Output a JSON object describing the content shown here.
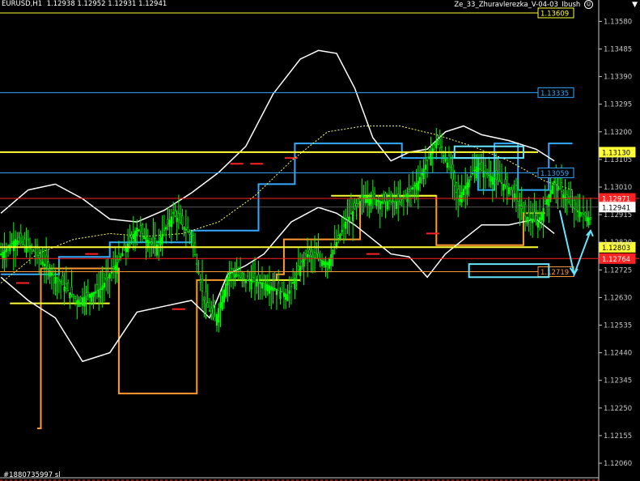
{
  "header": {
    "symbol": "EURUSD,H1",
    "ohlc": "1.12938 1.12952 1.12931 1.12941",
    "indicator": "Ze_33_Zhuravlerezka_V-04-03_Ibush"
  },
  "footer": {
    "text": "#1880735997 sl"
  },
  "colors": {
    "background": "#000000",
    "axis": "#c8c8c8",
    "candle": "#00ff00",
    "band": "#ffffff",
    "middle_dash": "#ffff66",
    "blue_step": "#33aaff",
    "orange_step": "#ff9933",
    "yellow_step": "#ffff33",
    "red_tick": "#ff2222",
    "cyan": "#66e6ff"
  },
  "chart_data": {
    "type": "line",
    "y_axis_ticks": [
      "1.13580",
      "1.13485",
      "1.13390",
      "1.13295",
      "1.13200",
      "1.13105",
      "1.13010",
      "1.12915",
      "1.12820",
      "1.12725",
      "1.12630",
      "1.12535",
      "1.12440",
      "1.12345",
      "1.12250",
      "1.12155",
      "1.12060"
    ],
    "ylim": [
      1.1201,
      1.1362
    ],
    "n_bars": 330,
    "current_price": {
      "value": 1.12941,
      "label": "1.12941"
    },
    "horizontal_lines": [
      {
        "value": 1.13609,
        "label": "1.13609",
        "kind": "yellow-thin"
      },
      {
        "value": 1.13335,
        "label": "1.13335",
        "kind": "blue"
      },
      {
        "value": 1.1313,
        "label": "1.13130",
        "kind": "yellow-thick"
      },
      {
        "value": 1.13059,
        "label": "1.13059",
        "kind": "blue"
      },
      {
        "value": 1.12971,
        "label": "1.12971",
        "kind": "red"
      },
      {
        "value": 1.12803,
        "label": "1.12803",
        "kind": "yellow-thick"
      },
      {
        "value": 1.12764,
        "label": "1.12764",
        "kind": "red"
      },
      {
        "value": 1.12719,
        "label": "1.12719",
        "kind": "orange"
      }
    ],
    "close_path": [
      [
        0,
        1.1278
      ],
      [
        8,
        1.1283
      ],
      [
        18,
        1.1279
      ],
      [
        30,
        1.127
      ],
      [
        42,
        1.1262
      ],
      [
        55,
        1.1266
      ],
      [
        65,
        1.1276
      ],
      [
        75,
        1.1287
      ],
      [
        85,
        1.128
      ],
      [
        95,
        1.1292
      ],
      [
        105,
        1.1284
      ],
      [
        112,
        1.1262
      ],
      [
        118,
        1.1255
      ],
      [
        126,
        1.1272
      ],
      [
        135,
        1.1269
      ],
      [
        145,
        1.1268
      ],
      [
        158,
        1.1264
      ],
      [
        168,
        1.1278
      ],
      [
        180,
        1.1275
      ],
      [
        190,
        1.1289
      ],
      [
        200,
        1.1298
      ],
      [
        210,
        1.1296
      ],
      [
        220,
        1.1296
      ],
      [
        230,
        1.1303
      ],
      [
        240,
        1.1317
      ],
      [
        247,
        1.1308
      ],
      [
        252,
        1.1297
      ],
      [
        262,
        1.1308
      ],
      [
        272,
        1.1304
      ],
      [
        282,
        1.13
      ],
      [
        289,
        1.1291
      ],
      [
        296,
        1.1289
      ],
      [
        305,
        1.1303
      ],
      [
        315,
        1.1294
      ],
      [
        325,
        1.129
      ]
    ],
    "channels": {
      "blue_upper": [
        [
          0,
          1.1271
        ],
        [
          32,
          1.1271
        ],
        [
          32,
          1.1277
        ],
        [
          60,
          1.1277
        ],
        [
          60,
          1.1282
        ],
        [
          105,
          1.1282
        ],
        [
          105,
          1.1286
        ],
        [
          142,
          1.1286
        ],
        [
          142,
          1.1302
        ],
        [
          162,
          1.1302
        ],
        [
          162,
          1.1316
        ],
        [
          221,
          1.1316
        ],
        [
          221,
          1.1311
        ],
        [
          263,
          1.1311
        ],
        [
          263,
          1.13
        ],
        [
          272,
          1.13
        ],
        [
          272,
          1.1316
        ],
        [
          285,
          1.1316
        ],
        [
          285,
          1.13
        ],
        [
          302,
          1.13
        ],
        [
          302,
          1.1316
        ],
        [
          315,
          1.1316
        ]
      ],
      "orange_lower": [
        [
          20,
          1.1218
        ],
        [
          20,
          1.1218
        ],
        [
          22,
          1.1218
        ],
        [
          22,
          1.1273
        ],
        [
          65,
          1.1273
        ],
        [
          65,
          1.123
        ],
        [
          108,
          1.123
        ],
        [
          108,
          1.1269
        ],
        [
          152,
          1.1269
        ],
        [
          152,
          1.1271
        ],
        [
          156,
          1.1271
        ],
        [
          156,
          1.1283
        ],
        [
          198,
          1.1283
        ],
        [
          198,
          1.1298
        ],
        [
          240,
          1.1298
        ],
        [
          240,
          1.1281
        ],
        [
          288,
          1.1281
        ],
        [
          288,
          1.1292
        ],
        [
          300,
          1.1292
        ]
      ],
      "yellow_steps": [
        [
          5,
          1.1261
        ],
        [
          60,
          1.1261
        ],
        [
          125,
          1.1269
        ],
        [
          165,
          1.1269
        ],
        [
          182,
          1.1298
        ],
        [
          240,
          1.1298
        ]
      ],
      "red_ticks": [
        [
          12,
          1.1268
        ],
        [
          50,
          1.1278
        ],
        [
          98,
          1.1259
        ],
        [
          130,
          1.1309
        ],
        [
          141,
          1.1309
        ],
        [
          160,
          1.1311
        ],
        [
          205,
          1.1278
        ],
        [
          238,
          1.1285
        ],
        [
          282,
          1.1297
        ]
      ]
    },
    "bands": {
      "upper": [
        [
          0,
          1.1292
        ],
        [
          15,
          1.13
        ],
        [
          30,
          1.1302
        ],
        [
          45,
          1.1297
        ],
        [
          60,
          1.129
        ],
        [
          75,
          1.1289
        ],
        [
          90,
          1.1293
        ],
        [
          105,
          1.1299
        ],
        [
          120,
          1.1306
        ],
        [
          135,
          1.1315
        ],
        [
          150,
          1.1333
        ],
        [
          165,
          1.1345
        ],
        [
          175,
          1.1348
        ],
        [
          185,
          1.1347
        ],
        [
          195,
          1.1335
        ],
        [
          205,
          1.1318
        ],
        [
          215,
          1.131
        ],
        [
          225,
          1.1313
        ],
        [
          235,
          1.1314
        ],
        [
          245,
          1.132
        ],
        [
          255,
          1.1322
        ],
        [
          265,
          1.1319
        ],
        [
          280,
          1.1317
        ],
        [
          295,
          1.1314
        ],
        [
          305,
          1.131
        ]
      ],
      "lower": [
        [
          0,
          1.127
        ],
        [
          15,
          1.1262
        ],
        [
          30,
          1.1256
        ],
        [
          45,
          1.1241
        ],
        [
          60,
          1.1244
        ],
        [
          75,
          1.1258
        ],
        [
          90,
          1.126
        ],
        [
          105,
          1.1262
        ],
        [
          115,
          1.1256
        ],
        [
          125,
          1.1271
        ],
        [
          135,
          1.1274
        ],
        [
          145,
          1.1278
        ],
        [
          160,
          1.1289
        ],
        [
          175,
          1.1294
        ],
        [
          185,
          1.1292
        ],
        [
          195,
          1.1288
        ],
        [
          205,
          1.1283
        ],
        [
          215,
          1.1278
        ],
        [
          225,
          1.1277
        ],
        [
          235,
          1.127
        ],
        [
          245,
          1.1278
        ],
        [
          255,
          1.1283
        ],
        [
          265,
          1.1288
        ],
        [
          280,
          1.1288
        ],
        [
          295,
          1.129
        ],
        [
          305,
          1.1285
        ]
      ],
      "middle": [
        [
          0,
          1.1268
        ],
        [
          20,
          1.1278
        ],
        [
          40,
          1.1283
        ],
        [
          60,
          1.1285
        ],
        [
          80,
          1.1284
        ],
        [
          100,
          1.1285
        ],
        [
          120,
          1.1289
        ],
        [
          140,
          1.1298
        ],
        [
          160,
          1.131
        ],
        [
          180,
          1.132
        ],
        [
          200,
          1.1322
        ],
        [
          220,
          1.1322
        ],
        [
          240,
          1.1319
        ],
        [
          260,
          1.1315
        ],
        [
          280,
          1.131
        ],
        [
          300,
          1.1303
        ],
        [
          315,
          1.13
        ]
      ]
    },
    "annotation_boxes": [
      {
        "x": [
          250,
          288
        ],
        "y": [
          1.1311,
          1.1315
        ]
      },
      {
        "x": [
          258,
          302
        ],
        "y": [
          1.127,
          1.12745
        ]
      }
    ],
    "forecast_arrow": [
      [
        308,
        1.1293
      ],
      [
        316,
        1.1271
      ],
      [
        325,
        1.1286
      ]
    ]
  }
}
